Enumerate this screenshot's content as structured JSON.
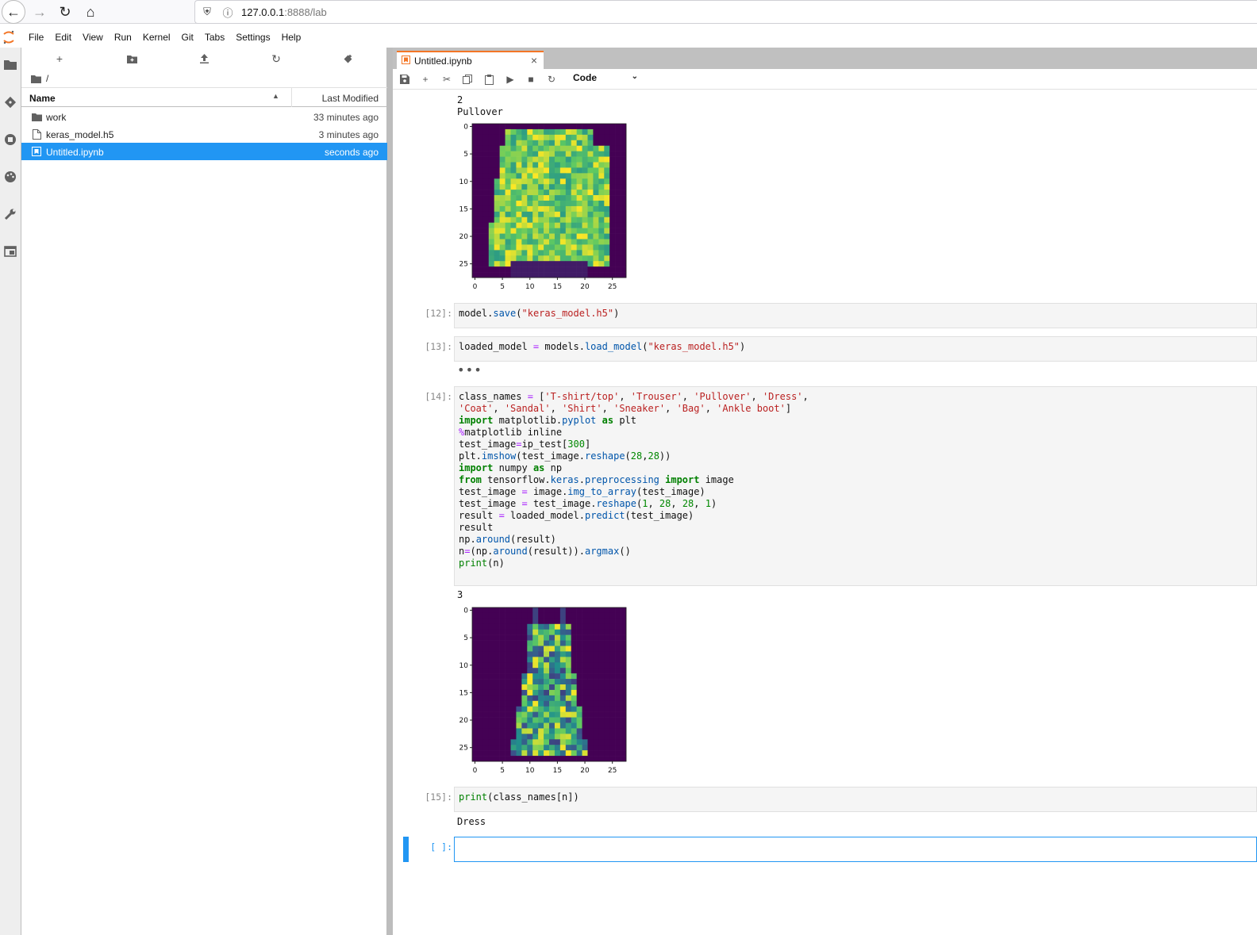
{
  "browser": {
    "url_host": "127.0.0.1",
    "url_path": ":8888/lab"
  },
  "menu": [
    "File",
    "Edit",
    "View",
    "Run",
    "Kernel",
    "Git",
    "Tabs",
    "Settings",
    "Help"
  ],
  "filebrowser": {
    "breadcrumb": "/",
    "col_name": "Name",
    "col_modified": "Last Modified",
    "files": [
      {
        "name": "work",
        "modified": "33 minutes ago",
        "icon": "folder-icon"
      },
      {
        "name": "keras_model.h5",
        "modified": "3 minutes ago",
        "icon": "file-icon"
      },
      {
        "name": "Untitled.ipynb",
        "modified": "seconds ago",
        "icon": "notebook-icon"
      }
    ]
  },
  "tab": {
    "label": "Untitled.ipynb"
  },
  "toolbar": {
    "cell_type": "Code"
  },
  "outputs": {
    "top_text": "2\nPullover",
    "cell14_out": "3",
    "cell15_out": "Dress"
  },
  "prompts": {
    "c12": "[12]:",
    "c13": "[13]:",
    "c14": "[14]:",
    "c15": "[15]:",
    "empty": "[ ]:"
  },
  "plots": {
    "y_ticks": [
      "0",
      "5",
      "10",
      "15",
      "20",
      "25"
    ],
    "x_ticks": [
      "0",
      "5",
      "10",
      "15",
      "20",
      "25"
    ]
  },
  "colors": {
    "accent": "#2196f3",
    "jupyter_orange": "#f37626",
    "viridis_dark": "#440154",
    "viridis_yellow": "#fde725"
  }
}
